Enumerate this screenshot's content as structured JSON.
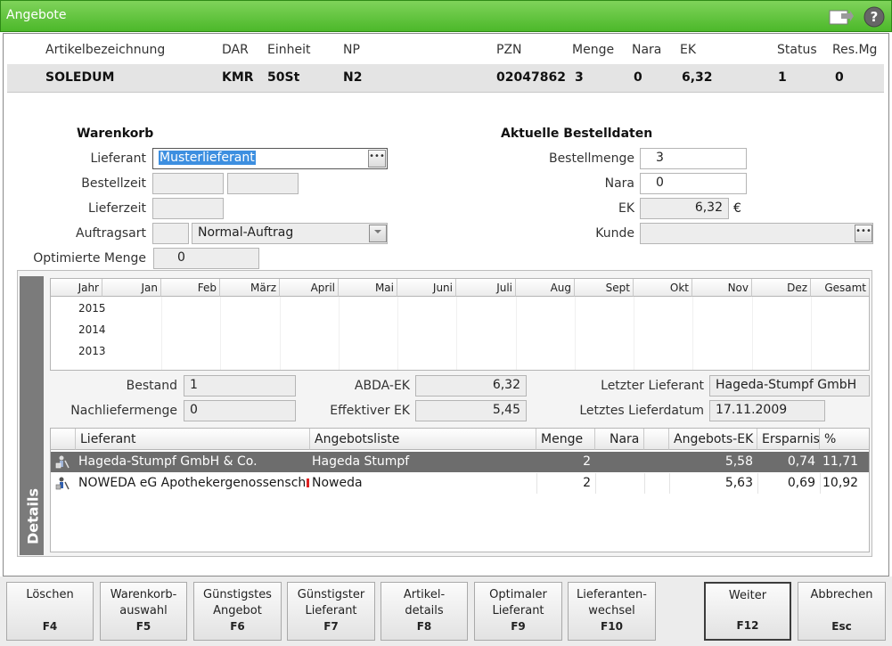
{
  "window": {
    "title": "Angebote"
  },
  "article": {
    "headers": [
      "Artikelbezeichnung",
      "DAR",
      "Einheit",
      "NP",
      "PZN",
      "Menge",
      "Nara",
      "EK",
      "Status",
      "Res.Mg"
    ],
    "values": [
      "SOLEDUM",
      "KMR",
      "50St",
      "N2",
      "02047862",
      "3",
      "0",
      "6,32",
      "1",
      "0"
    ]
  },
  "warenkorb": {
    "title": "Warenkorb",
    "lieferant_label": "Lieferant",
    "lieferant_value": "Musterlieferant",
    "bestellzeit_label": "Bestellzeit",
    "lieferzeit_label": "Lieferzeit",
    "auftragsart_label": "Auftragsart",
    "auftragsart_value": "Normal-Auftrag",
    "optimierte_label": "Optimierte Menge",
    "optimierte_value": "0"
  },
  "bestelldaten": {
    "title": "Aktuelle Bestelldaten",
    "bestellmenge_label": "Bestellmenge",
    "bestellmenge_value": "3",
    "nara_label": "Nara",
    "nara_value": "0",
    "ek_label": "EK",
    "ek_value": "6,32",
    "currency": "€",
    "kunde_label": "Kunde",
    "kunde_value": ""
  },
  "details": {
    "tab_label": "Details",
    "grid": {
      "headers": [
        "Jahr",
        "Jan",
        "Feb",
        "März",
        "April",
        "Mai",
        "Juni",
        "Juli",
        "Aug",
        "Sept",
        "Okt",
        "Nov",
        "Dez",
        "Gesamt"
      ],
      "years": [
        "2015",
        "2014",
        "2013"
      ]
    },
    "bestand_label": "Bestand",
    "bestand_value": "1",
    "nachliefer_label": "Nachliefermenge",
    "nachliefer_value": "0",
    "abda_label": "ABDA-EK",
    "abda_value": "6,32",
    "eff_label": "Effektiver EK",
    "eff_value": "5,45",
    "letzter_label": "Letzter Lieferant",
    "letzter_value": "Hageda-Stumpf GmbH",
    "datum_label": "Letztes Lieferdatum",
    "datum_value": "17.11.2009",
    "offers": {
      "headers": [
        "Lieferant",
        "Angebotsliste",
        "Menge",
        "Nara",
        "",
        "Angebots-EK",
        "Ersparnis",
        "%"
      ],
      "rows": [
        {
          "lieferant": "Hageda-Stumpf GmbH & Co.",
          "liste": "Hageda Stumpf",
          "menge": "2",
          "nara": "",
          "ek": "5,58",
          "ersparnis": "0,74",
          "pct": "11,71",
          "selected": true
        },
        {
          "lieferant": "NOWEDA eG Apothekergenossenschaft",
          "liste": "Noweda",
          "menge": "2",
          "nara": "",
          "ek": "5,63",
          "ersparnis": "0,69",
          "pct": "10,92",
          "selected": false
        }
      ]
    }
  },
  "fkeys": [
    {
      "label": "Löschen",
      "key": "F4"
    },
    {
      "label": "Warenkorb-\nauswahl",
      "key": "F5"
    },
    {
      "label": "Günstigstes\nAngebot",
      "key": "F6"
    },
    {
      "label": "Günstigster\nLieferant",
      "key": "F7"
    },
    {
      "label": "Artikel-\ndetails",
      "key": "F8"
    },
    {
      "label": "Optimaler\nLieferant",
      "key": "F9"
    },
    {
      "label": "Lieferanten-\nwechsel",
      "key": "F10"
    },
    {
      "label": "Weiter",
      "key": "F12"
    },
    {
      "label": "Abbrechen",
      "key": "Esc"
    }
  ],
  "colors": {
    "titlebar": "#4cb82a",
    "selection": "#3d8fe0",
    "selected_row": "#6d6d6d",
    "details_tab": "#7b7b7b"
  }
}
